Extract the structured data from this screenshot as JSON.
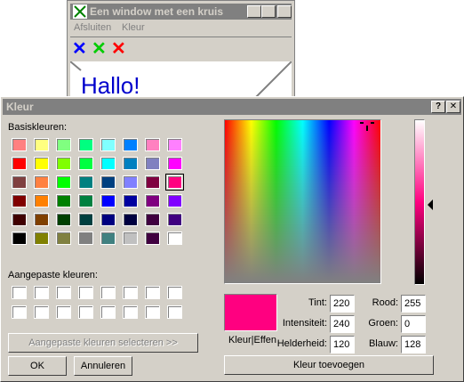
{
  "bg_window": {
    "title": "Een window met een kruis",
    "menu": [
      "Afsluiten",
      "Kleur"
    ],
    "toolbar": [
      {
        "glyph": "✕",
        "color": "#0000ff"
      },
      {
        "glyph": "✕",
        "color": "#00cc00"
      },
      {
        "glyph": "✕",
        "color": "#ff0000"
      }
    ],
    "greeting": "Hallo!"
  },
  "dialog": {
    "title": "Kleur",
    "help_glyph": "?",
    "close_glyph": "✕",
    "basic_label": "Basiskleuren:",
    "custom_label": "Aangepaste kleuren:",
    "basic_colors": [
      [
        "#ff8080",
        "#ffff80",
        "#80ff80",
        "#00ff80",
        "#80ffff",
        "#0080ff",
        "#ff80c0",
        "#ff80ff"
      ],
      [
        "#ff0000",
        "#ffff00",
        "#80ff00",
        "#00ff40",
        "#00ffff",
        "#0080c0",
        "#8080c0",
        "#ff00ff"
      ],
      [
        "#804040",
        "#ff8040",
        "#00ff00",
        "#008080",
        "#004080",
        "#8080ff",
        "#800040",
        "#ff0080"
      ],
      [
        "#800000",
        "#ff8000",
        "#008000",
        "#008040",
        "#0000ff",
        "#0000a0",
        "#800080",
        "#8000ff"
      ],
      [
        "#400000",
        "#804000",
        "#004000",
        "#004040",
        "#000080",
        "#000040",
        "#400040",
        "#400080"
      ],
      [
        "#000000",
        "#808000",
        "#808040",
        "#808080",
        "#408080",
        "#c0c0c0",
        "#400040",
        "#ffffff"
      ]
    ],
    "selected": "#ff0080",
    "define_button": "Aangepaste kleuren selecteren >>",
    "ok": "OK",
    "cancel": "Annuleren",
    "preview_label": "Kleur|Effen",
    "fields": {
      "tint": {
        "label": "Tint:",
        "value": "220"
      },
      "intensity": {
        "label": "Intensiteit:",
        "value": "240"
      },
      "brightness": {
        "label": "Helderheid:",
        "value": "120"
      },
      "red": {
        "label": "Rood:",
        "value": "255"
      },
      "green": {
        "label": "Groen:",
        "value": "0"
      },
      "blue": {
        "label": "Blauw:",
        "value": "128"
      }
    },
    "add_button": "Kleur toevoegen"
  }
}
